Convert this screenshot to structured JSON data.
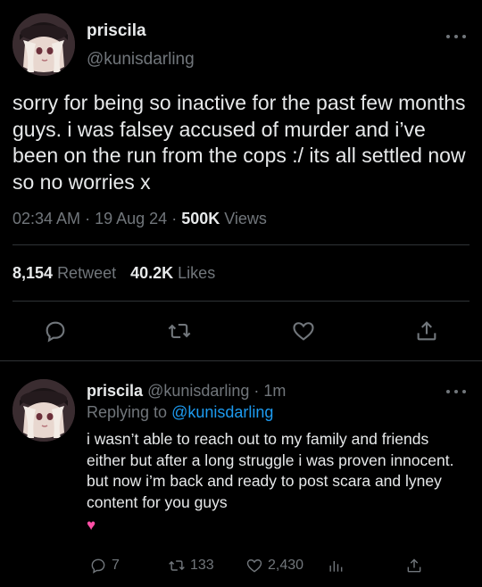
{
  "main_tweet": {
    "display_name": "priscila",
    "handle": "@kunisdarling",
    "text": "sorry for being so inactive for the past few months guys. i was falsey accused of murder and i’ve been on the run from the cops :/ its all settled now so no worries x",
    "time": "02:34 AM",
    "date": "19 Aug 24",
    "views_count": "500K",
    "views_label": "Views",
    "retweets_count": "8,154",
    "retweets_label": "Retweet",
    "likes_count": "40.2K",
    "likes_label": "Likes"
  },
  "reply": {
    "display_name": "priscila",
    "handle": "@kunisdarling",
    "age": "1m",
    "replying_label": "Replying to",
    "replying_to": "@kunisdarling",
    "text": "i wasn’t able to reach out to my family and friends either but after a long struggle i was proven innocent. but now i’m back and ready to post scara and lyney content for you guys",
    "emoji": "♥",
    "replies_count": "7",
    "retweets_count": "133",
    "likes_count": "2,430"
  },
  "icons": [
    "more-icon",
    "reply-icon",
    "retweet-icon",
    "like-icon",
    "share-icon",
    "analytics-icon"
  ],
  "colors": {
    "background": "#000000",
    "text": "#e7e9ea",
    "muted": "#71767b",
    "link": "#1d9bf0",
    "divider": "#2f3336",
    "heart": "#ff4fa6"
  }
}
